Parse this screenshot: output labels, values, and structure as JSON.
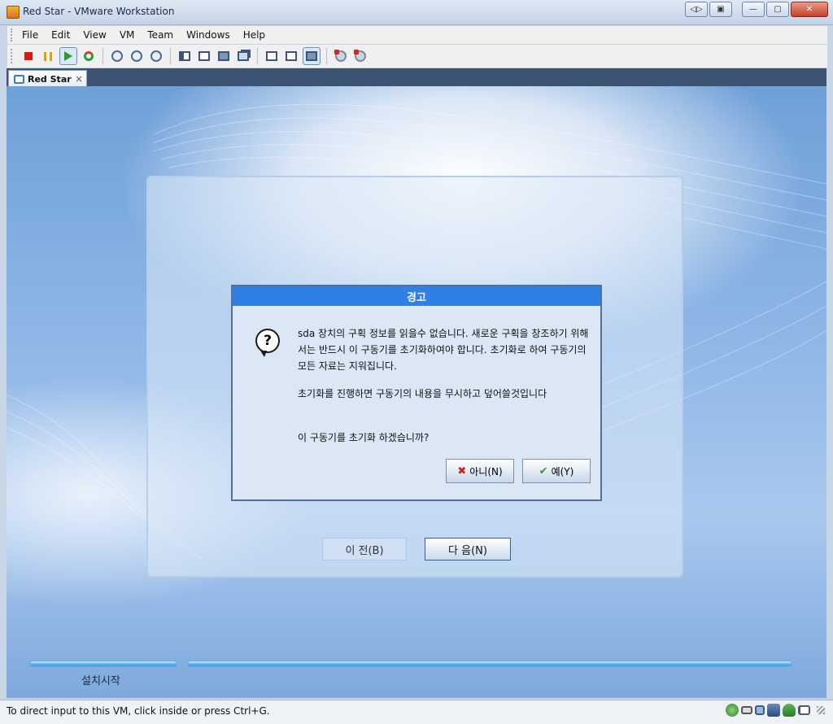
{
  "window": {
    "title": "Red Star - VMware Workstation",
    "controls": [
      "restore-toggle",
      "minimize",
      "maximize",
      "close"
    ]
  },
  "menu": [
    "File",
    "Edit",
    "View",
    "VM",
    "Team",
    "Windows",
    "Help"
  ],
  "toolbar": {
    "buttons": [
      "power-off",
      "suspend",
      "power-on",
      "reset",
      "snapshot",
      "revert-snapshot",
      "snapshot-manager",
      "normal-view",
      "full-screen",
      "quick-switch",
      "summary",
      "console",
      "appliance-view",
      "unity",
      "preferences"
    ],
    "active": "appliance-view"
  },
  "tabs": [
    {
      "label": "Red Star",
      "close": "×"
    }
  ],
  "installer": {
    "prev_label": "이 전(B)",
    "next_label": "다 음(N)",
    "progress_label": "설치시작"
  },
  "dialog": {
    "title": "경고",
    "icon": "question-icon",
    "message1": "sda 장치의 구획 정보를 읽을수 없습니다. 새로운 구획을 창조하기 위해서는 반드시 이 구동기를 초기화하여야 합니다. 초기화로 하여 구동기의 모든 자료는 지워집니다.",
    "message2": "초기화를 진행하면 구동기의 내용을 무시하고 덮어쓸것입니다",
    "message3": "이 구동기를 초기화 하겠습니까?",
    "no_label": "아니(N)",
    "yes_label": "예(Y)"
  },
  "status": {
    "text": "To direct input to this VM, click inside or press Ctrl+G.",
    "icons": [
      "network-icon",
      "hdd-icon",
      "floppy-icon",
      "usb-icon",
      "sound-icon",
      "printer-icon",
      "message-icon"
    ]
  },
  "colors": {
    "dialog_title": "#2f7fe4",
    "desktop": "#8db6e6",
    "tabstrip": "#3d5374"
  }
}
